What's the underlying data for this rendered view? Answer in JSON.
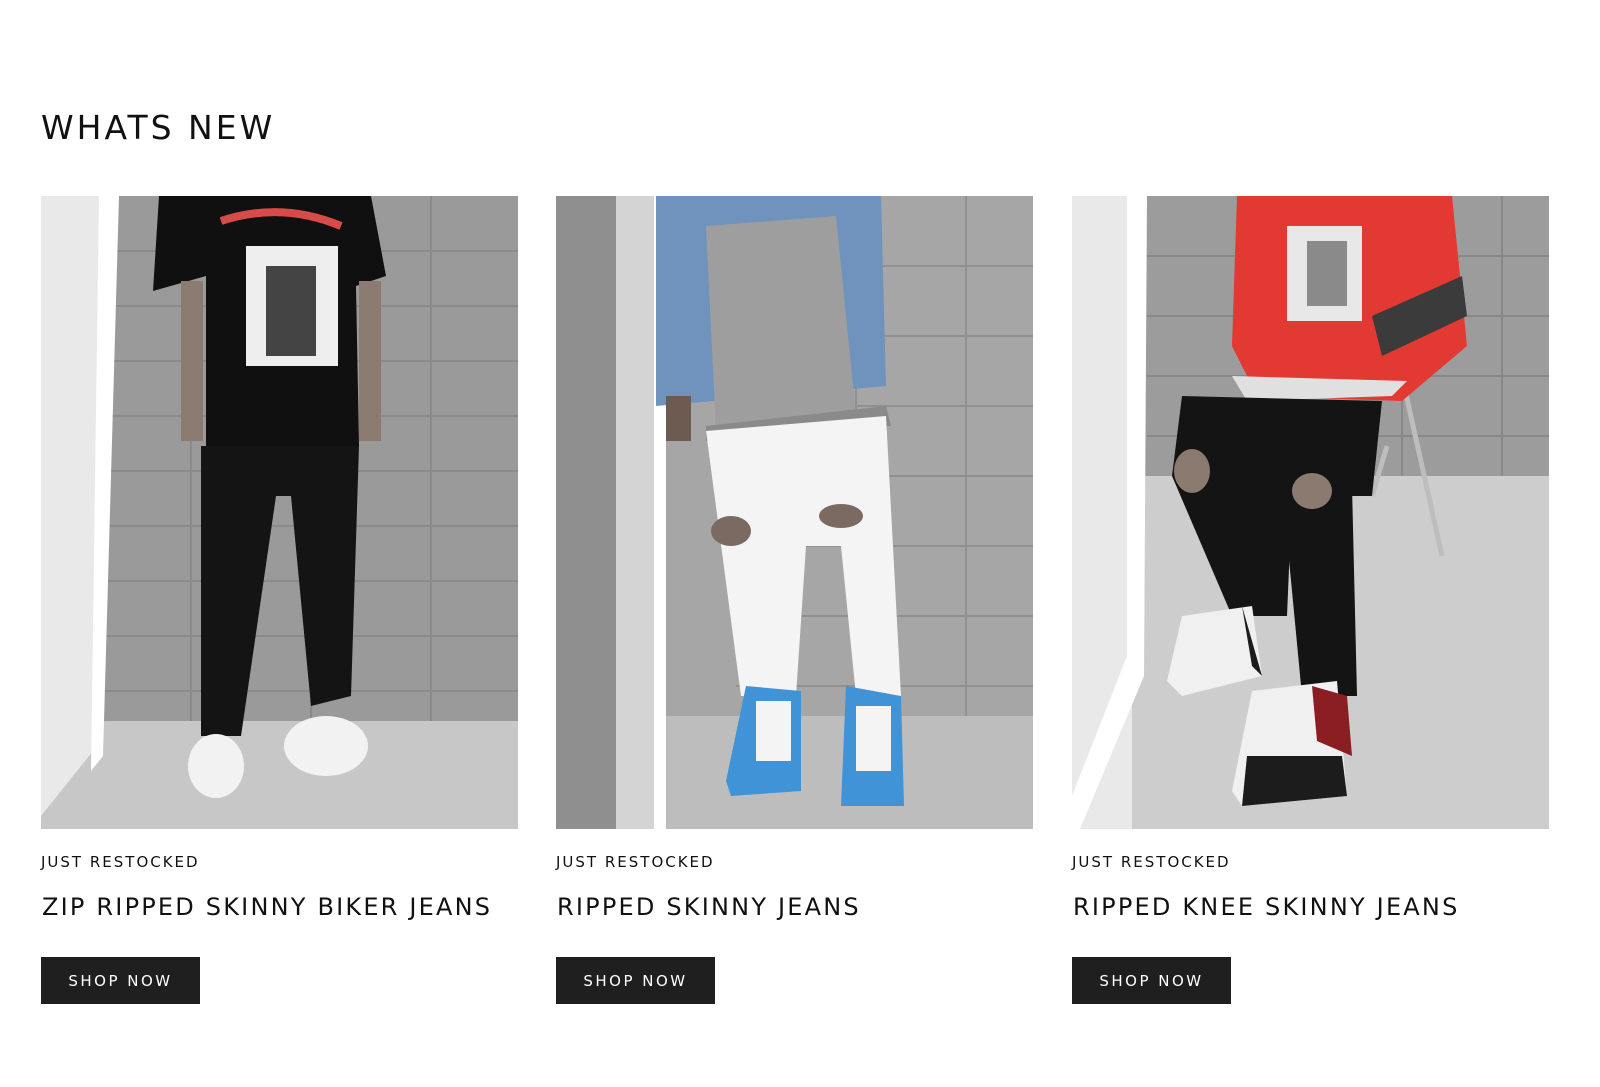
{
  "section": {
    "title": "WHATS NEW"
  },
  "products": [
    {
      "eyebrow": "JUST RESTOCKED",
      "title": "ZIP RIPPED SKINNY BIKER JEANS",
      "cta": "SHOP NOW",
      "image_alt": "model wearing black graphic tee, black biker jeans and white sneakers"
    },
    {
      "eyebrow": "JUST RESTOCKED",
      "title": "RIPPED SKINNY JEANS",
      "cta": "SHOP NOW",
      "image_alt": "model wearing denim jacket, white ripped jeans and blue high-top sneakers"
    },
    {
      "eyebrow": "JUST RESTOCKED",
      "title": "RIPPED KNEE SKINNY JEANS",
      "cta": "SHOP NOW",
      "image_alt": "seated model wearing red hoodie, black ripped knee jeans and black-red-white high-top sneakers"
    }
  ],
  "colors": {
    "button_bg": "#1f1f1f",
    "button_text": "#ffffff",
    "text": "#111111",
    "hoodie_red": "#e23a33",
    "sneaker_blue": "#3f93d6"
  }
}
